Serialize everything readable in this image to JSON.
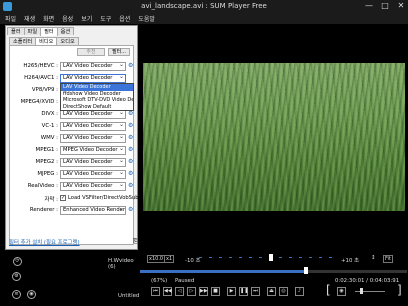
{
  "window": {
    "title": "avi_landscape.avi : SUM Player Free",
    "buttons": [
      "—",
      "□",
      "✕"
    ]
  },
  "menu": [
    "파일",
    "재생",
    "화면",
    "음성",
    "보기",
    "도구",
    "옵션",
    "도움말"
  ],
  "panel": {
    "top_tabs": [
      "플러",
      "파일",
      "필터",
      "옵션"
    ],
    "active_top_tab": 2,
    "sub_tabs": [
      "소플리터",
      "비디오",
      "오디오"
    ],
    "active_sub_tab": 1,
    "remove_button": "추천",
    "add_button": "필터...",
    "rows": [
      {
        "label": "H265/HEVC :",
        "value": "LAV Video Decoder"
      },
      {
        "label": "H264/AVC1 :",
        "value": "LAV Video Decoder"
      },
      {
        "label": "VP8/VP9 :",
        "value": "LAV Video Decoder"
      },
      {
        "label": "MPEG4/XVID :",
        "value": "LAV Video Decoder"
      },
      {
        "label": "DIVX :",
        "value": "LAV Video Decoder"
      },
      {
        "label": "VC-1 :",
        "value": "LAV Video Decoder"
      },
      {
        "label": "WMV :",
        "value": "LAV Video Decoder"
      },
      {
        "label": "MPEG1 :",
        "value": "MPEG Video Decoder"
      },
      {
        "label": "MPEG2 :",
        "value": "LAV Video Decoder"
      },
      {
        "label": "MJPEG :",
        "value": "LAV Video Decoder"
      },
      {
        "label": "RealVideo :",
        "value": "LAV Video Decoder"
      }
    ],
    "dropdown_options": [
      "LAV Video Decoder",
      "ffdshow Video Decoder",
      "Microsoft DTV-DVD Video Decoder",
      "DirectShow Default"
    ],
    "dropdown_selected": 0,
    "subtitle_label": "자막 :",
    "subtitle_checkbox": "Load VSFilter/DirectVobSub",
    "renderer_label": "Renderer :",
    "renderer_value": "Enhanced Video Renderer (C",
    "link_text": "필터 추가 설치 (필요 프로그램)",
    "corner_icon": "⎘"
  },
  "status": {
    "codec": "H.Wvideo (6)",
    "untitled": "Untitled"
  },
  "controls": {
    "speed": "x10.0",
    "speed_box2": "x1",
    "minus10": "-10 초",
    "plus10": "+10 초",
    "fit_label": "Fit",
    "volume": "(67%)",
    "paused": "Paused",
    "time": "0:02:30:01 / 0:04:03:91",
    "progress_fraction": 0.62,
    "seek_thumb_fraction": 0.62
  }
}
